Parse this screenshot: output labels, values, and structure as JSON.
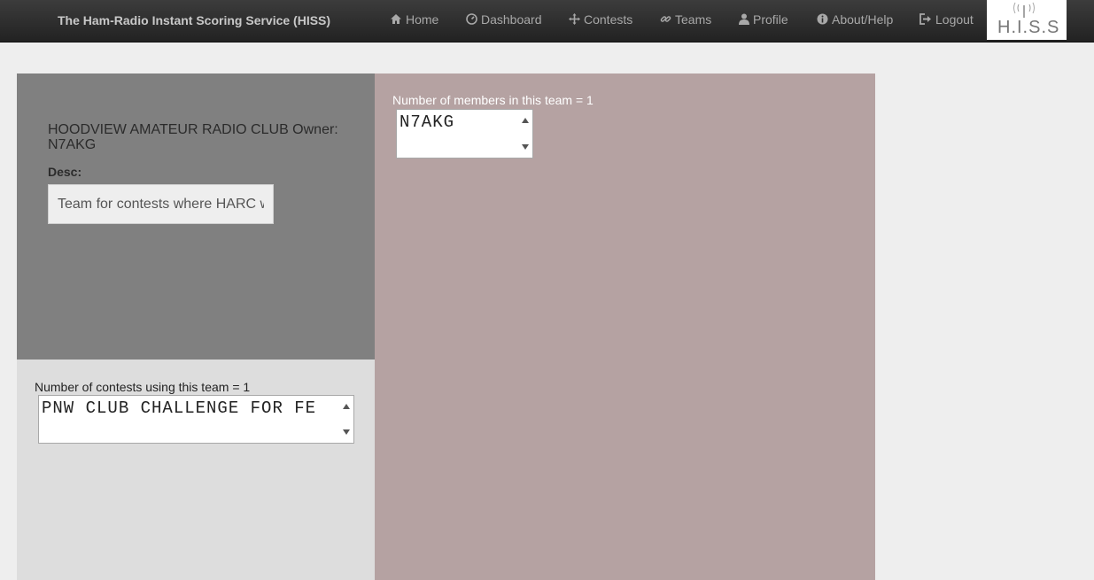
{
  "navbar": {
    "brand": "The Ham-Radio Instant Scoring Service (HISS)",
    "items": [
      {
        "label": "Home",
        "icon": "home-icon"
      },
      {
        "label": "Dashboard",
        "icon": "dashboard-icon"
      },
      {
        "label": "Contests",
        "icon": "move-icon"
      },
      {
        "label": "Teams",
        "icon": "link-icon"
      },
      {
        "label": "Profile",
        "icon": "user-icon"
      },
      {
        "label": "About/Help",
        "icon": "info-icon"
      },
      {
        "label": "Logout",
        "icon": "logout-icon"
      }
    ],
    "logo_text": "H.I.S.S"
  },
  "team": {
    "name_owner": "HOODVIEW AMATEUR RADIO CLUB Owner: N7AKG",
    "desc_label": "Desc:",
    "desc_value": "Team for contests where HARC w"
  },
  "contests": {
    "label": "Number of contests using this team = 1",
    "items": [
      "PNW CLUB CHALLENGE FOR FE"
    ]
  },
  "members": {
    "label": "Number of members in this team = 1",
    "items": [
      "N7AKG"
    ]
  },
  "colors": {
    "navbar": "#2e2e2e",
    "team_panel": "#808080",
    "contests_panel": "#dddddd",
    "members_panel": "#b5a2a2"
  }
}
